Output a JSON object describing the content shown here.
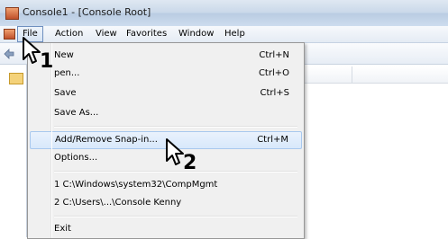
{
  "window": {
    "title": "Console1 - [Console Root]"
  },
  "menubar": {
    "items": [
      "File",
      "Action",
      "View",
      "Favorites",
      "Window",
      "Help"
    ]
  },
  "file_menu": {
    "items": [
      {
        "label": "New",
        "shortcut": "Ctrl+N"
      },
      {
        "label": "pen...",
        "shortcut": "Ctrl+O"
      },
      {
        "label": "Save",
        "shortcut": "Ctrl+S"
      },
      {
        "label": "Save As...",
        "shortcut": ""
      },
      {
        "label": "Add/Remove Snap-in...",
        "shortcut": "Ctrl+M"
      },
      {
        "label": "Options...",
        "shortcut": ""
      },
      {
        "label": "1 C:\\Windows\\system32\\CompMgmt",
        "shortcut": ""
      },
      {
        "label": "2 C:\\Users\\...\\Console Kenny",
        "shortcut": ""
      },
      {
        "label": "Exit",
        "shortcut": ""
      }
    ]
  },
  "steps": [
    "1",
    "2"
  ],
  "colors": {
    "highlight": "#d8e8fb",
    "menu_bg": "#f0f0f0"
  }
}
